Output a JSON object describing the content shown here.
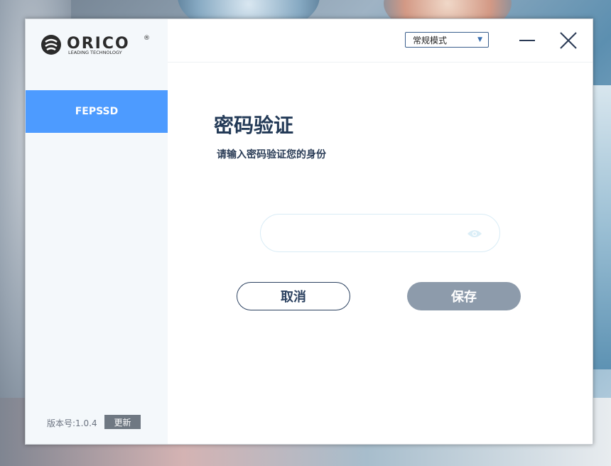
{
  "app": {
    "brand": "ORICO",
    "brand_tagline": "LEADING TECHNOLOGY"
  },
  "sidebar": {
    "items": [
      {
        "label": "FEPSSD",
        "active": true
      }
    ],
    "version_label": "版本号:1.0.4",
    "update_label": "更新"
  },
  "topbar": {
    "mode_select": {
      "value": "常规模式"
    },
    "minimize_icon": "minimize-icon",
    "close_icon": "close-icon"
  },
  "main": {
    "title": "密码验证",
    "subtitle": "请输入密码验证您的身份",
    "password": {
      "value": "",
      "placeholder": "",
      "reveal_icon": "eye-icon"
    },
    "cancel_label": "取消",
    "save_label": "保存"
  },
  "colors": {
    "accent": "#4d9bff",
    "title": "#233a57",
    "save_disabled": "#8d9bab",
    "sidebar_bg": "#f4f8fb"
  }
}
